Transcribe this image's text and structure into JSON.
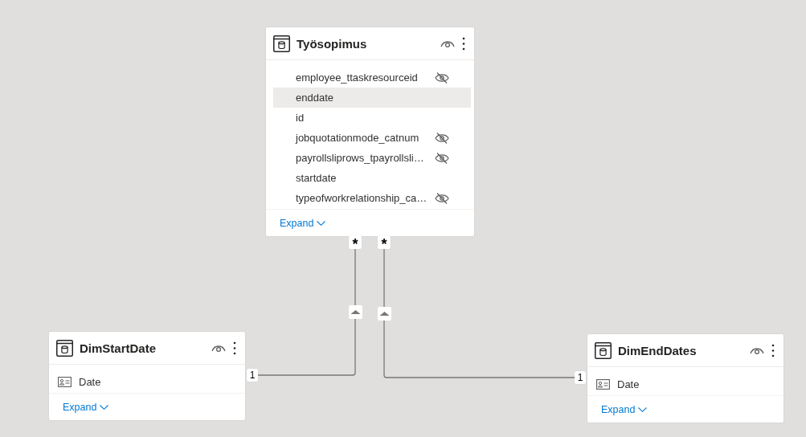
{
  "tables": [
    {
      "name": "Työsopimus",
      "hidden": false,
      "columns": [
        {
          "name": "employee_ttaskresourceid",
          "kind": "plain",
          "hidden": true,
          "highlighted": false
        },
        {
          "name": "enddate",
          "kind": "plain",
          "hidden": false,
          "highlighted": true
        },
        {
          "name": "id",
          "kind": "plain",
          "hidden": false,
          "highlighted": false
        },
        {
          "name": "jobquotationmode_catnum",
          "kind": "plain",
          "hidden": true,
          "highlighted": false
        },
        {
          "name": "payrollsliprows_tpayrollsli…",
          "kind": "plain",
          "hidden": true,
          "highlighted": false
        },
        {
          "name": "startdate",
          "kind": "plain",
          "hidden": false,
          "highlighted": false
        },
        {
          "name": "typeofworkrelationship_ca…",
          "kind": "plain",
          "hidden": true,
          "highlighted": false
        }
      ],
      "expand_label": "Expand"
    },
    {
      "name": "DimStartDate",
      "hidden": false,
      "columns": [
        {
          "name": "Date",
          "kind": "card",
          "hidden": false,
          "highlighted": false
        }
      ],
      "expand_label": "Expand"
    },
    {
      "name": "DimEndDates",
      "hidden": false,
      "columns": [
        {
          "name": "Date",
          "kind": "card",
          "hidden": false,
          "highlighted": false
        }
      ],
      "expand_label": "Expand"
    }
  ],
  "relationships": [
    {
      "many_label": "*",
      "one_label": "1"
    },
    {
      "many_label": "*",
      "one_label": "1"
    }
  ]
}
